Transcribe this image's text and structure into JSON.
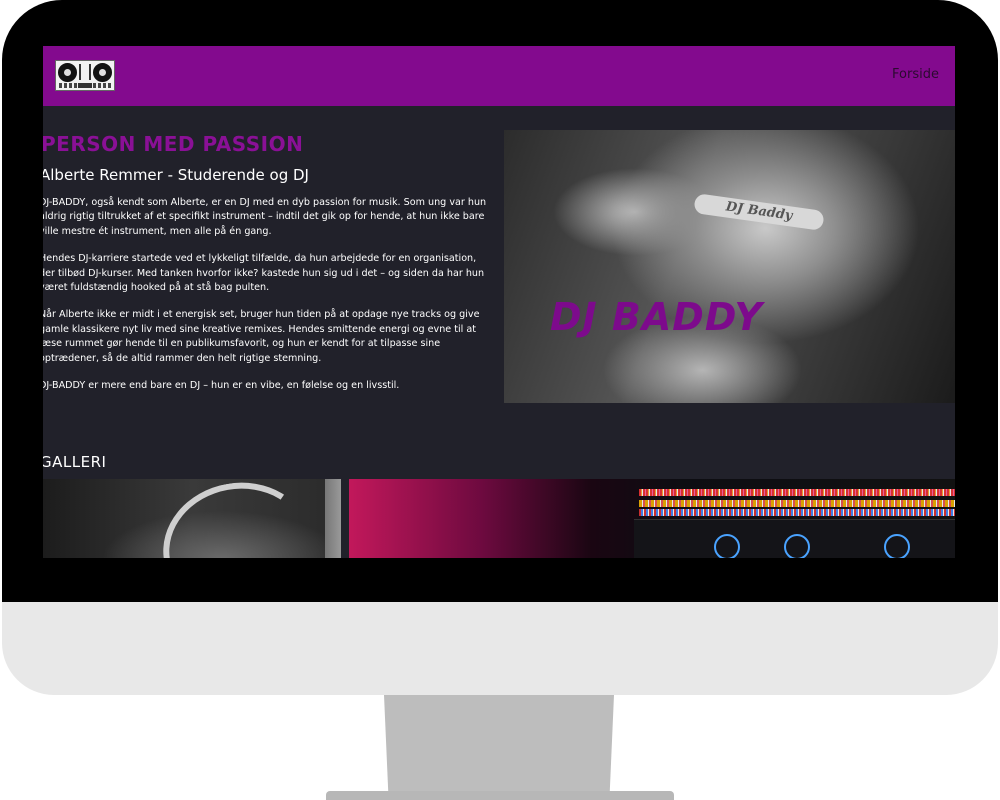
{
  "header": {
    "logo_icon": "dj-controller-icon",
    "nav_link": "Forside"
  },
  "hero": {
    "heading": "PERSON MED PASSION",
    "subheading": "Alberte Remmer - Studerende og DJ",
    "paragraphs": [
      "DJ-BADDY, også kendt som Alberte, er en DJ med en dyb passion for musik. Som ung var hun aldrig rigtig tiltrukket af et specifikt instrument – indtil det gik op for hende, at hun ikke bare ville mestre ét instrument, men alle på én gang.",
      "Hendes DJ-karriere startede ved et lykkeligt tilfælde, da hun arbejdede for en organisation, der tilbød DJ-kurser. Med tanken hvorfor ikke? kastede hun sig ud i det – og siden da har hun været fuldstændig hooked på at stå bag pulten.",
      "Når Alberte ikke er midt i et energisk set, bruger hun tiden på at opdage nye tracks og give gamle klassikere nyt liv med sine kreative remixes. Hendes smittende energi og evne til at læse rummet gør hende til en publikumsfavorit, og hun er kendt for at tilpasse sine optrædener, så de altid rammer den helt rigtige stemning.",
      "DJ-BADDY er mere end bare en DJ – hun er en vibe, en følelse og en livsstil."
    ],
    "image_overlay": "DJ BADDY",
    "image_prop_text": "DJ Baddy"
  },
  "gallery": {
    "heading": "GALLERI"
  },
  "colors": {
    "accent": "#830a8e",
    "page_background": "#21212a",
    "text": "#ffffff"
  }
}
